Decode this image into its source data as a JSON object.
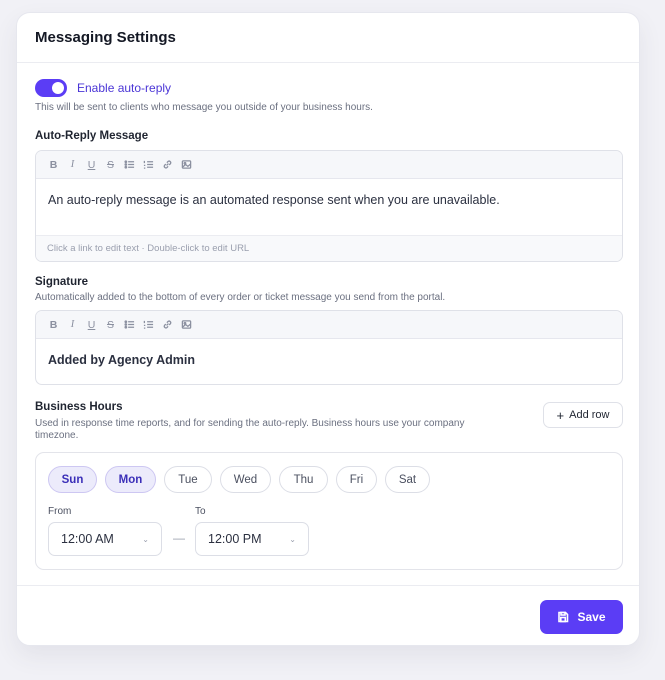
{
  "title": "Messaging Settings",
  "auto_reply": {
    "toggle_label": "Enable auto-reply",
    "enabled": true,
    "help": "This will be sent to clients who message you outside of your business hours.",
    "message_label": "Auto-Reply Message",
    "message_text": "An auto-reply message is an automated response sent when you are unavailable.",
    "hint": "Click a link to edit text · Double-click to edit URL"
  },
  "toolbar": {
    "bold": "B",
    "italic": "I",
    "underline": "U",
    "strike": "S"
  },
  "signature": {
    "label": "Signature",
    "help": "Automatically added to the bottom of every order or ticket message you send from the portal.",
    "text": "Added by Agency Admin"
  },
  "business_hours": {
    "label": "Business Hours",
    "help_line1": "Used in response time reports, and for sending the auto-reply. Business hours use your company",
    "help_line2": "timezone.",
    "add_row": "Add row",
    "days": [
      {
        "label": "Sun",
        "active": true
      },
      {
        "label": "Mon",
        "active": true
      },
      {
        "label": "Tue",
        "active": false
      },
      {
        "label": "Wed",
        "active": false
      },
      {
        "label": "Thu",
        "active": false
      },
      {
        "label": "Fri",
        "active": false
      },
      {
        "label": "Sat",
        "active": false
      }
    ],
    "from_label": "From",
    "to_label": "To",
    "from_value": "12:00 AM",
    "to_value": "12:00 PM",
    "separator": "—"
  },
  "save": "Save",
  "colors": {
    "accent": "#5b3df5",
    "background": "#f1f1f6"
  }
}
